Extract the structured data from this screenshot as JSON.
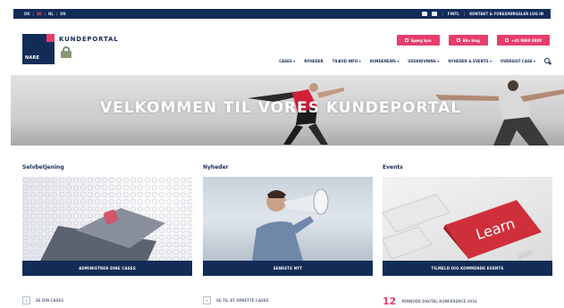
{
  "topbar": {
    "languages": [
      "DK",
      "SE",
      "NL",
      "EN"
    ],
    "active_index": 1,
    "contact": "FINTL",
    "login": "KONTAKT & FORESPØRGSLER LOG IN"
  },
  "brand": {
    "logo_text": "NARE",
    "title": "KUNDEPORTAL"
  },
  "header_buttons": [
    {
      "label": "Spørg kun"
    },
    {
      "label": "Bliv klog"
    },
    {
      "label": "+45 8888 8888"
    }
  ],
  "nav": [
    {
      "label": "CASES",
      "caret": true
    },
    {
      "label": "NYHEDER",
      "caret": false
    },
    {
      "label": "TILBUD INFO",
      "caret": true
    },
    {
      "label": "KUNDENEWS",
      "caret": true
    },
    {
      "label": "UDSKRIVNING",
      "caret": true
    },
    {
      "label": "NYHEDER & EVENTS",
      "caret": true
    },
    {
      "label": "OVERSIGT CASE",
      "caret": true
    }
  ],
  "hero": {
    "title": "VELKOMMEN TIL VORES KUNDEPORTAL"
  },
  "sections": [
    {
      "heading": "Selvbetjening",
      "button": "ADMINISTRER DINE CASES",
      "footer": "SE DIN CASES"
    },
    {
      "heading": "Nyheder",
      "button": "SENESTE NYT",
      "footer": "SE TIL AT OPRETTE CASES"
    },
    {
      "heading": "Events",
      "button": "TILMELD DIG KOMMENDE EVENTS",
      "footer": "PERNODE DIGITAL KONFERENCE 2016",
      "footer_number": "12"
    }
  ],
  "colors": {
    "navy": "#132c57",
    "pink": "#e63d6c"
  }
}
